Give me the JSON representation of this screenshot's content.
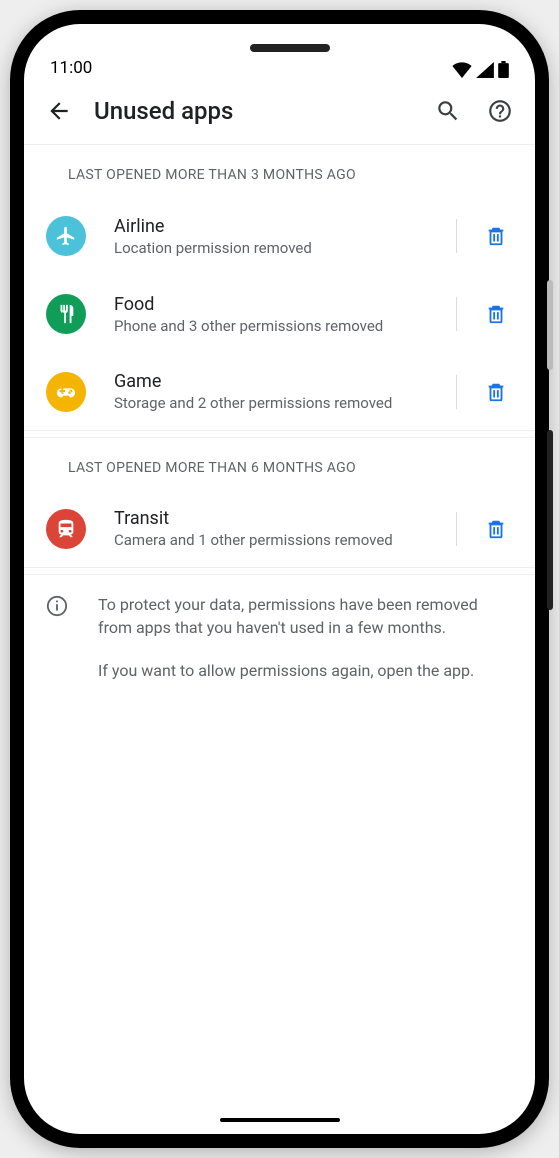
{
  "status": {
    "time": "11:00"
  },
  "header": {
    "title": "Unused apps"
  },
  "sections": [
    {
      "label": "LAST OPENED MORE THAN 3 MONTHS AGO",
      "apps": [
        {
          "name": "Airline",
          "sub": "Location permission removed",
          "color": "#4bc2d9",
          "icon": "airplane"
        },
        {
          "name": "Food",
          "sub": "Phone and 3 other permissions removed",
          "color": "#0f9d58",
          "icon": "fork-knife"
        },
        {
          "name": "Game",
          "sub": "Storage and 2 other permissions removed",
          "color": "#f4b400",
          "icon": "gamepad"
        }
      ]
    },
    {
      "label": "LAST OPENED MORE THAN 6 MONTHS AGO",
      "apps": [
        {
          "name": "Transit",
          "sub": "Camera and 1 other permissions removed",
          "color": "#db4437",
          "icon": "train"
        }
      ]
    }
  ],
  "info": {
    "p1": "To protect your data, permissions have been removed from  apps that you haven't used in a few months.",
    "p2": "If you want to allow permissions again, open the app."
  }
}
